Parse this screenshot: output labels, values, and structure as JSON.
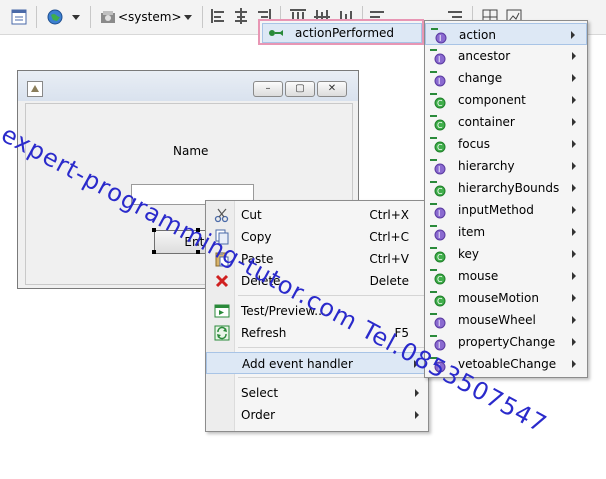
{
  "toolbar": {
    "combo_value": "<system>",
    "icons": [
      "form-icon",
      "globe-icon",
      "look-and-feel-icon",
      "align-left-icon",
      "align-center-icon",
      "align-right-icon",
      "distribute-icon",
      "grid-icon"
    ]
  },
  "form": {
    "name_label": "Name",
    "enter_button": "Enter",
    "controls": [
      "–",
      "▢",
      "✕"
    ]
  },
  "context_menu": {
    "items": [
      {
        "label": "Cut",
        "shortcut": "Ctrl+X",
        "icon": "scissors-icon"
      },
      {
        "label": "Copy",
        "shortcut": "Ctrl+C",
        "icon": "copy-icon"
      },
      {
        "label": "Paste",
        "shortcut": "Ctrl+V",
        "icon": "paste-icon"
      },
      {
        "label": "Delete",
        "shortcut": "Delete",
        "icon": "delete-icon"
      },
      {
        "label": "Test/Preview...",
        "shortcut": "",
        "icon": "preview-icon"
      },
      {
        "label": "Refresh",
        "shortcut": "F5",
        "icon": "refresh-icon"
      },
      {
        "label": "Add event handler",
        "shortcut": "",
        "icon": ""
      },
      {
        "label": "Select",
        "shortcut": "",
        "icon": ""
      },
      {
        "label": "Order",
        "shortcut": "",
        "icon": ""
      }
    ]
  },
  "event_menu": {
    "items": [
      "action",
      "ancestor",
      "change",
      "component",
      "container",
      "focus",
      "hierarchy",
      "hierarchyBounds",
      "inputMethod",
      "item",
      "key",
      "mouse",
      "mouseMotion",
      "mouseWheel",
      "propertyChange",
      "vetoableChange"
    ]
  },
  "submenu": {
    "label": "actionPerformed"
  },
  "watermark": {
    "text": "expert-programming-tutor.com Tel.0853507547"
  },
  "colors": {
    "highlight": "#dde8f5",
    "submenu_border": "#e896b4",
    "watermark": "#2a2acb"
  }
}
